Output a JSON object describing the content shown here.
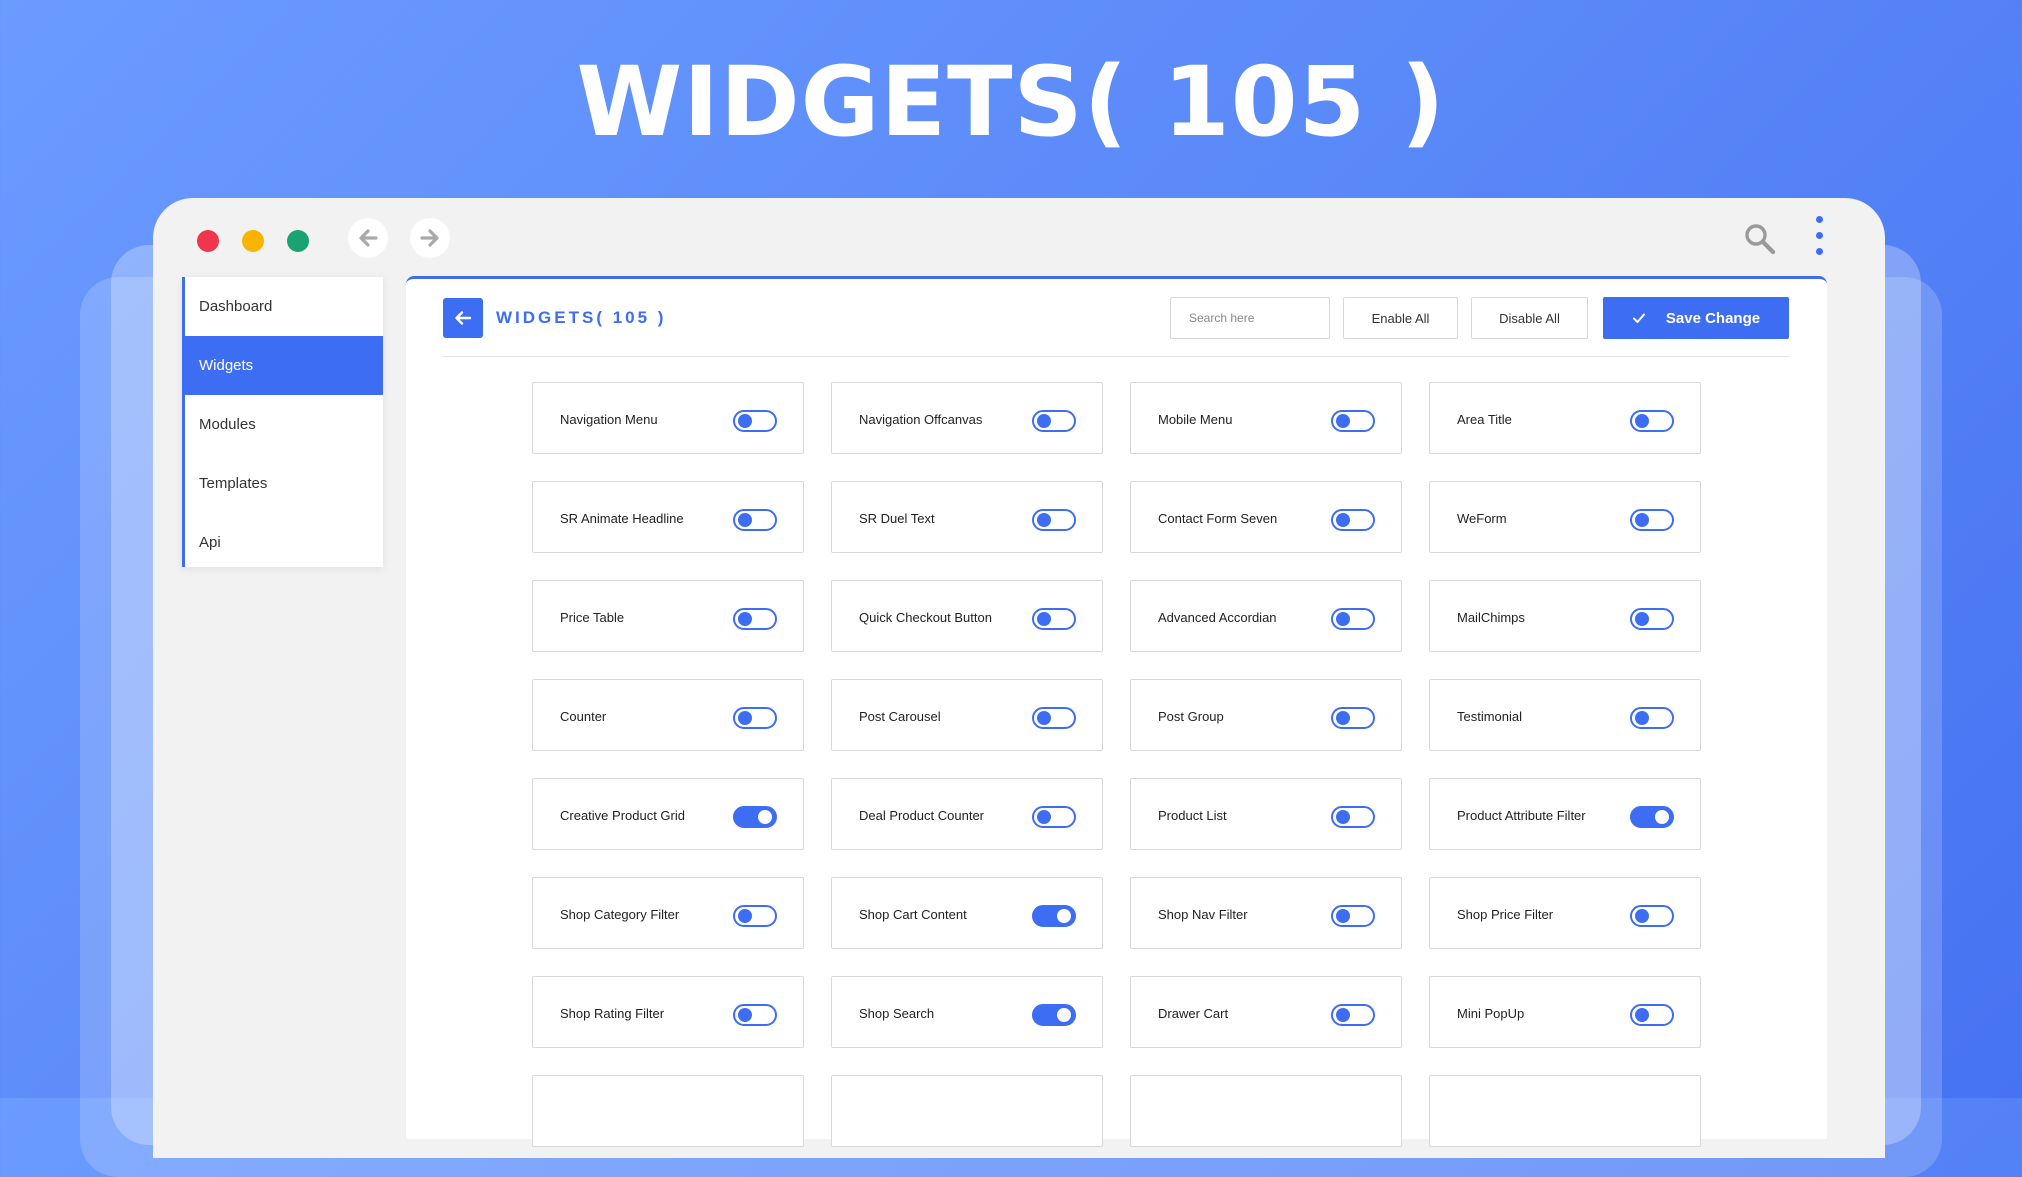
{
  "hero": {
    "title": "WIDGETS( 105 )"
  },
  "browser": {
    "window_controls": [
      "close",
      "minimize",
      "maximize"
    ],
    "nav_icons": [
      "arrow-left-icon",
      "arrow-right-icon"
    ],
    "toolbar_icons": [
      "search-icon",
      "kebab-menu-icon"
    ]
  },
  "sidebar": {
    "items": [
      {
        "label": "Dashboard",
        "active": false
      },
      {
        "label": "Widgets",
        "active": true
      },
      {
        "label": "Modules",
        "active": false
      },
      {
        "label": "Templates",
        "active": false
      },
      {
        "label": "Api",
        "active": false
      }
    ]
  },
  "panel": {
    "title": "WIDGETS( 105 )",
    "search_placeholder": "Search here",
    "enable_all_label": "Enable All",
    "disable_all_label": "Disable All",
    "save_label": "Save Change"
  },
  "widgets": [
    {
      "label": "Navigation Menu",
      "enabled": false
    },
    {
      "label": "Navigation Offcanvas",
      "enabled": false
    },
    {
      "label": "Mobile Menu",
      "enabled": false
    },
    {
      "label": "Area Title",
      "enabled": false
    },
    {
      "label": "SR Animate Headline",
      "enabled": false
    },
    {
      "label": "SR Duel Text",
      "enabled": false
    },
    {
      "label": "Contact Form Seven",
      "enabled": false
    },
    {
      "label": "WeForm",
      "enabled": false
    },
    {
      "label": "Price Table",
      "enabled": false
    },
    {
      "label": "Quick Checkout Button",
      "enabled": false
    },
    {
      "label": "Advanced Accordian",
      "enabled": false
    },
    {
      "label": "MailChimps",
      "enabled": false
    },
    {
      "label": "Counter",
      "enabled": false
    },
    {
      "label": "Post Carousel",
      "enabled": false
    },
    {
      "label": "Post Group",
      "enabled": false
    },
    {
      "label": "Testimonial",
      "enabled": false
    },
    {
      "label": "Creative Product Grid",
      "enabled": true
    },
    {
      "label": "Deal Product Counter",
      "enabled": false
    },
    {
      "label": "Product List",
      "enabled": false
    },
    {
      "label": "Product Attribute Filter",
      "enabled": true
    },
    {
      "label": "Shop Category Filter",
      "enabled": false
    },
    {
      "label": "Shop Cart Content",
      "enabled": true
    },
    {
      "label": "Shop Nav Filter",
      "enabled": false
    },
    {
      "label": "Shop Price Filter",
      "enabled": false
    },
    {
      "label": "Shop Rating Filter",
      "enabled": false
    },
    {
      "label": "Shop Search",
      "enabled": true
    },
    {
      "label": "Drawer Cart",
      "enabled": false
    },
    {
      "label": "Mini PopUp",
      "enabled": false
    },
    {
      "label": "",
      "enabled": null
    },
    {
      "label": "",
      "enabled": null
    },
    {
      "label": "",
      "enabled": null
    },
    {
      "label": "",
      "enabled": null
    }
  ],
  "colors": {
    "accent": "#3d6df2",
    "background_gradient_start": "#6a9bff",
    "background_gradient_end": "#4673f2",
    "dot_red": "#f0364d",
    "dot_yellow": "#f8b400",
    "dot_green": "#1aa272"
  }
}
